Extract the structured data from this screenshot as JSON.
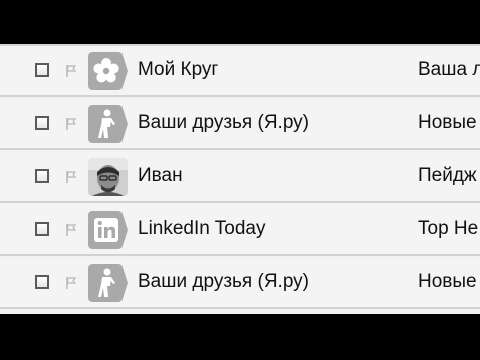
{
  "mail_list": {
    "rows": [
      {
        "sender": "Мой Круг",
        "subject": "Ваша л",
        "avatar_icon": "flower-icon"
      },
      {
        "sender": "Ваши друзья (Я.ру)",
        "subject": "Новые",
        "avatar_icon": "person-icon"
      },
      {
        "sender": "Иван",
        "subject": "Пейдж",
        "avatar_icon": "user-photo"
      },
      {
        "sender": "LinkedIn Today",
        "subject": "Top Не",
        "avatar_icon": "linkedin-icon"
      },
      {
        "sender": "Ваши друзья (Я.ру)",
        "subject": "Новые",
        "avatar_icon": "person-icon"
      }
    ]
  },
  "colors": {
    "row_background": "#f4f4f4",
    "divider": "#d2d2d2",
    "avatar_gray": "#a9a9a9",
    "letterbox": "#000000"
  }
}
